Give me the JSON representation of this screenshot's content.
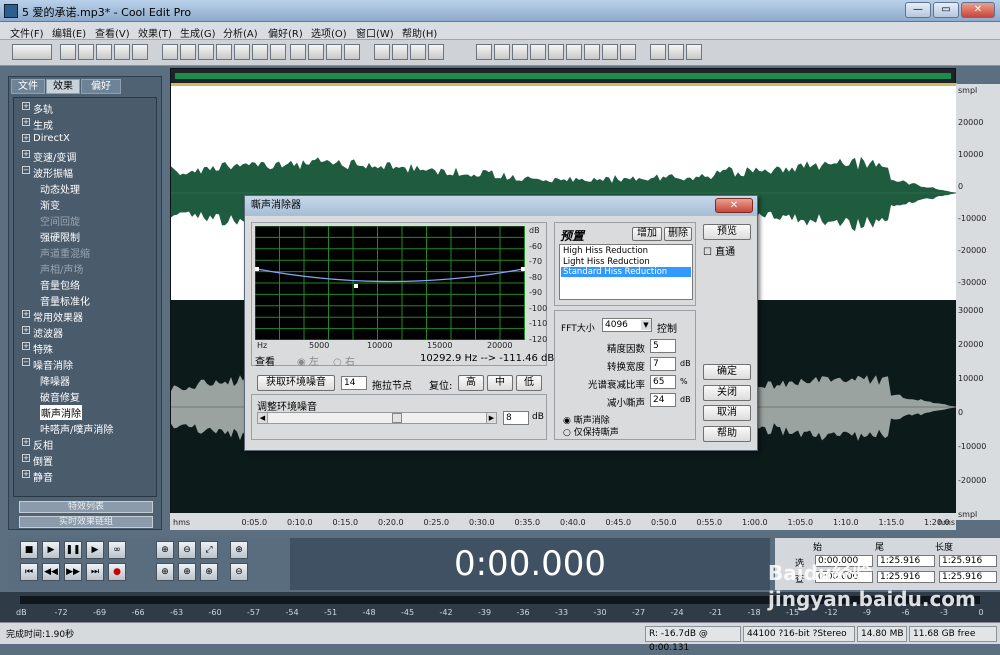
{
  "window": {
    "title": "5 爱的承诺.mp3* - Cool Edit Pro",
    "min_glyph": "—",
    "max_glyph": "▭",
    "close_glyph": "✕"
  },
  "menu": [
    "文件(F)",
    "编辑(E)",
    "查看(V)",
    "效果(T)",
    "生成(G)",
    "分析(A)",
    "偏好(R)",
    "选项(O)",
    "窗口(W)",
    "帮助(H)"
  ],
  "panel": {
    "tabs": [
      "文件",
      "效果",
      "偏好"
    ],
    "tree": [
      {
        "label": "多轨",
        "type": "plus"
      },
      {
        "label": "生成",
        "type": "plus"
      },
      {
        "label": "DirectX",
        "type": "plus"
      },
      {
        "label": "变速/变调",
        "type": "plus"
      },
      {
        "label": "波形振幅",
        "type": "minus"
      },
      {
        "label": "动态处理",
        "type": "leaf"
      },
      {
        "label": "渐变",
        "type": "leaf"
      },
      {
        "label": "空间回旋",
        "type": "leaf",
        "disabled": true
      },
      {
        "label": "强硬限制",
        "type": "leaf"
      },
      {
        "label": "声道重混缩",
        "type": "leaf",
        "disabled": true
      },
      {
        "label": "声相/声场",
        "type": "leaf",
        "disabled": true
      },
      {
        "label": "音量包络",
        "type": "leaf"
      },
      {
        "label": "音量标准化",
        "type": "leaf"
      },
      {
        "label": "常用效果器",
        "type": "plus"
      },
      {
        "label": "滤波器",
        "type": "plus"
      },
      {
        "label": "特殊",
        "type": "plus"
      },
      {
        "label": "噪音消除",
        "type": "minus"
      },
      {
        "label": "降噪器",
        "type": "leaf"
      },
      {
        "label": "破音修复",
        "type": "leaf"
      },
      {
        "label": "嘶声消除",
        "type": "leaf",
        "selected": true
      },
      {
        "label": "咔嗒声/噗声消除",
        "type": "leaf"
      },
      {
        "label": "反相",
        "type": "plusleaf"
      },
      {
        "label": "倒置",
        "type": "plusleaf"
      },
      {
        "label": "静音",
        "type": "plusleaf"
      }
    ],
    "buttons": [
      "特效列表",
      "实时效果链组"
    ]
  },
  "waveform": {
    "ruler_unit": "smpl",
    "ruler_top": [
      "smpl",
      "20000",
      "10000",
      "0",
      "-10000",
      "-20000",
      "-30000"
    ],
    "ruler_bottom": [
      "30000",
      "20000",
      "10000",
      "0",
      "-10000",
      "-20000",
      "smpl"
    ],
    "time_labels": [
      "hms",
      "0:05.0",
      "0:10.0",
      "0:15.0",
      "0:20.0",
      "0:25.0",
      "0:30.0",
      "0:35.0",
      "0:40.0",
      "0:45.0",
      "0:50.0",
      "0:55.0",
      "1:00.0",
      "1:05.0",
      "1:10.0",
      "1:15.0",
      "1:20.0",
      "hms"
    ]
  },
  "dialog": {
    "title": "嘶声消除器",
    "close_label": "✕",
    "graph": {
      "db_labels": [
        "dB",
        "-60",
        "-70",
        "-80",
        "-90",
        "-100",
        "-110",
        "-120"
      ],
      "hz_labels": [
        "Hz",
        "5000",
        "10000",
        "15000",
        "20000"
      ]
    },
    "view_label": "查看",
    "left_label": "左",
    "right_label": "右",
    "readout": "10292.9 Hz --> -111.46 dB",
    "get_noise_button": "获取环境噪音",
    "node_count": "14",
    "drag_nodes_label": "拖拉节点",
    "reset_label": "复位:",
    "high_button": "高",
    "mid_button": "中",
    "low_button": "低",
    "adjust_label": "调整环境噪音",
    "slider_value": "8",
    "slider_unit": "dB",
    "preset_title": "预置",
    "add_button": "增加",
    "delete_button": "删除",
    "presets": [
      "High Hiss Reduction",
      "Light Hiss Reduction",
      "Standard Hiss Reduction"
    ],
    "selected_preset": 2,
    "fft_label": "FFT大小",
    "fft_value": "4096",
    "control_label": "控制",
    "params": [
      {
        "label": "精度因数",
        "value": "5",
        "unit": ""
      },
      {
        "label": "转换宽度",
        "value": "7",
        "unit": "dB"
      },
      {
        "label": "光谱衰减比率",
        "value": "65",
        "unit": "%"
      },
      {
        "label": "减小嘶声",
        "value": "24",
        "unit": "dB"
      }
    ],
    "radio_remove": "嘶声消除",
    "radio_keep": "仅保持嘶声",
    "preview_button": "预览",
    "bypass_label": "直通",
    "ok_button": "确定",
    "close_button": "关闭",
    "cancel_button": "取消",
    "help_button": "帮助"
  },
  "transport": {
    "time": "0:00.000",
    "headers": [
      "始",
      "尾",
      "长度"
    ],
    "row1_label": "选",
    "row2_label": "查",
    "sel_begin": "0:00.000",
    "sel_end": "1:25.916",
    "sel_length": "1:25.916",
    "view_begin": "0:00.000",
    "view_end": "1:25.916",
    "view_length": "1:25.916"
  },
  "db_ruler": [
    "dB",
    "-72",
    "-69",
    "-66",
    "-63",
    "-60",
    "-57",
    "-54",
    "-51",
    "-48",
    "-45",
    "-42",
    "-39",
    "-36",
    "-33",
    "-30",
    "-27",
    "-24",
    "-21",
    "-18",
    "-15",
    "-12",
    "-9",
    "-6",
    "-3",
    "0"
  ],
  "status": {
    "left": "完成时间:1.90秒",
    "level": "R: -16.7dB @ 0:00.131",
    "format": "44100 ?16-bit ?Stereo",
    "size": "14.80 MB",
    "free": "11.68 GB free"
  },
  "watermark": "Baidu经验 jingyan.baidu.com"
}
